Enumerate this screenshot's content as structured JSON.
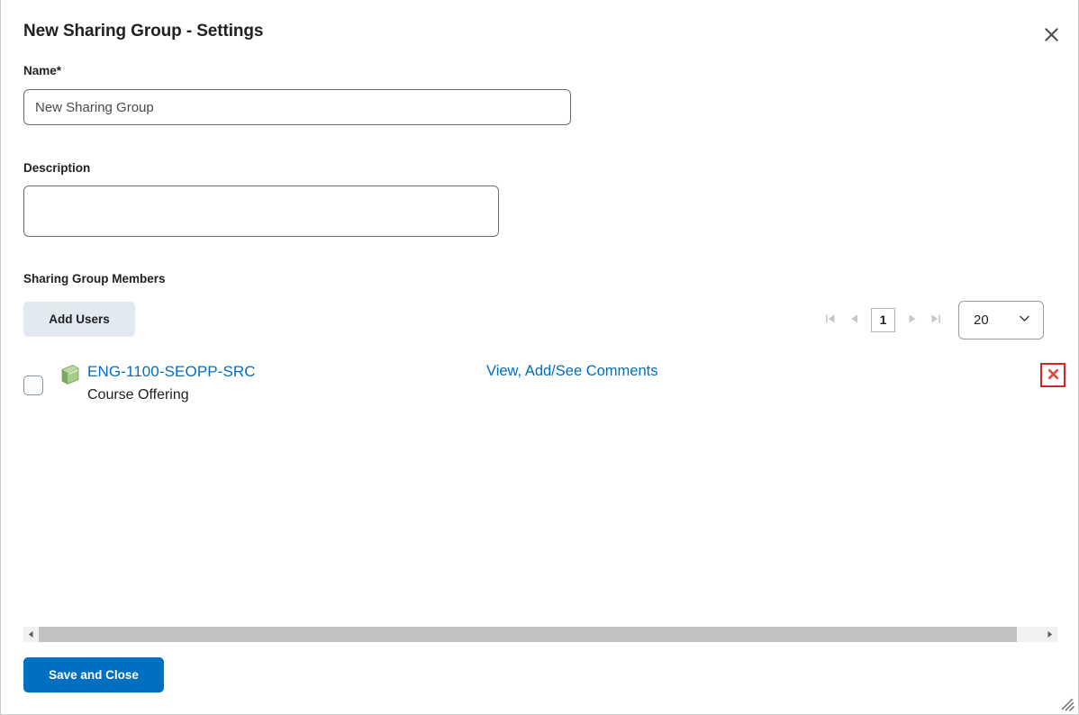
{
  "dialog": {
    "title": "New Sharing Group - Settings",
    "close_label": "Close",
    "close_icon": "close-icon",
    "resize_icon": "resize-grip-icon"
  },
  "form": {
    "name": {
      "label": "Name",
      "required_marker": "*",
      "value": "New Sharing Group",
      "placeholder": ""
    },
    "description": {
      "label": "Description",
      "value": "",
      "placeholder": ""
    }
  },
  "members_section": {
    "label": "Sharing Group Members",
    "add_users_label": "Add Users",
    "pagination": {
      "first_icon": "first-page-icon",
      "prev_icon": "previous-page-icon",
      "current_page": "1",
      "next_icon": "next-page-icon",
      "last_icon": "last-page-icon",
      "page_size_value": "20",
      "page_size_options": [
        "20"
      ],
      "chevron_icon": "chevron-down-icon"
    },
    "rows": [
      {
        "checkbox_checked": false,
        "type_icon": "course-book-icon",
        "title": "ENG-1100-SEOPP-SRC",
        "subtitle": "Course Offering",
        "comments_link": "View, Add/See Comments",
        "delete_icon": "delete-x-icon"
      }
    ]
  },
  "scrollbar": {
    "left_arrow_icon": "scroll-left-icon",
    "right_arrow_icon": "scroll-right-icon"
  },
  "footer": {
    "save_label": "Save and Close"
  },
  "colors": {
    "link": "#006fbf",
    "primary_button": "#006fbf",
    "secondary_button": "#e3e9f1",
    "delete_border": "#d22525",
    "delete_x": "#e0453e",
    "book_icon": "#8cba6e"
  }
}
